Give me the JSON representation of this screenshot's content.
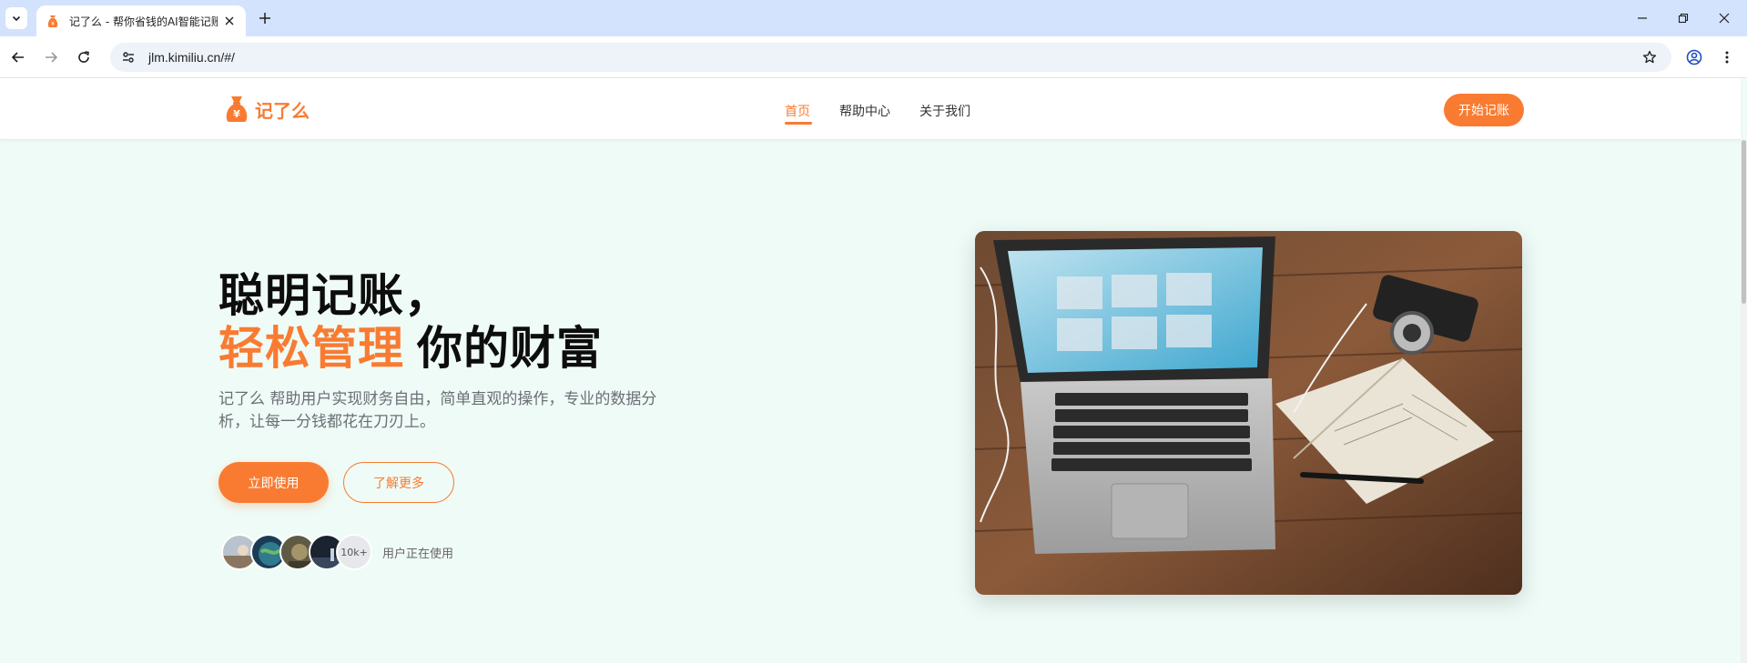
{
  "browser": {
    "tab_title": "记了么 - 帮你省钱的AI智能记账",
    "url": "jlm.kimiliu.cn/#/",
    "icons": {
      "tab_search": "chevron-down-icon",
      "favicon": "money-bag-icon",
      "close": "close-icon",
      "new_tab": "plus-icon",
      "back": "arrow-left-icon",
      "forward": "arrow-right-icon",
      "reload": "reload-icon",
      "site_info": "tune-icon",
      "bookmark": "star-icon",
      "profile": "profile-icon",
      "menu": "kebab-menu-icon"
    }
  },
  "site": {
    "logo_text": "记了么",
    "nav": [
      {
        "label": "首页",
        "active": true
      },
      {
        "label": "帮助中心",
        "active": false
      },
      {
        "label": "关于我们",
        "active": false
      }
    ],
    "header_cta": "开始记账",
    "brand_color": "#f97b32"
  },
  "hero": {
    "title_line1": "聪明记账，",
    "title_accent": "轻松管理",
    "title_rest": "你的财富",
    "description": "记了么 帮助用户实现财务自由，简单直观的操作，专业的数据分析，让每一分钱都花在刀刃上。",
    "primary_button": "立即使用",
    "secondary_button": "了解更多",
    "user_count": "10k+",
    "users_label": "用户正在使用"
  }
}
